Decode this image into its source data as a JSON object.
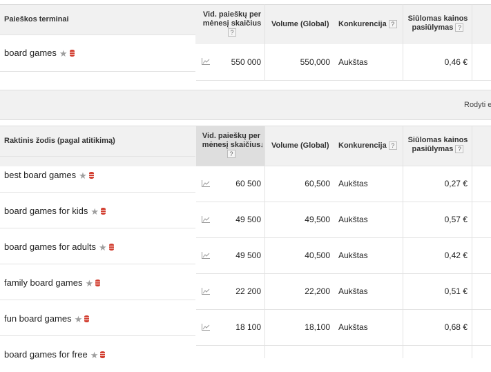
{
  "top_table": {
    "headers": {
      "search_terms": "Paieškos terminai",
      "avg_monthly": "Vid. paieškų per mėnesį skaičius",
      "volume": "Volume (Global)",
      "competition": "Konkurencija",
      "suggested_bid": "Siūlomas kainos pasiūlymas",
      "help": "?"
    },
    "row": {
      "keyword": "board games",
      "avg": "550 000",
      "volume": "550,000",
      "competition": "Aukštas",
      "bid": "0,46 €"
    }
  },
  "divider_bar": {
    "text": "Rodyti e"
  },
  "keyword_table": {
    "headers": {
      "keyword": "Raktinis žodis (pagal atitikimą)",
      "avg_monthly": "Vid. paieškų per mėnesį skaičius",
      "sort_arrow": "↓",
      "volume": "Volume (Global)",
      "competition": "Konkurencija",
      "suggested_bid": "Siūlomas kainos pasiūlymas",
      "help": "?"
    },
    "rows": [
      {
        "keyword": "best board games",
        "avg": "60 500",
        "volume": "60,500",
        "competition": "Aukštas",
        "bid": "0,27 €"
      },
      {
        "keyword": "board games for kids",
        "avg": "49 500",
        "volume": "49,500",
        "competition": "Aukštas",
        "bid": "0,57 €"
      },
      {
        "keyword": "board games for adults",
        "avg": "49 500",
        "volume": "40,500",
        "competition": "Aukštas",
        "bid": "0,42 €"
      },
      {
        "keyword": "family board games",
        "avg": "22 200",
        "volume": "22,200",
        "competition": "Aukštas",
        "bid": "0,51 €"
      },
      {
        "keyword": "fun board games",
        "avg": "18 100",
        "volume": "18,100",
        "competition": "Aukštas",
        "bid": "0,68 €"
      },
      {
        "keyword": "board games for free",
        "avg": "",
        "volume": "",
        "competition": "",
        "bid": ""
      }
    ]
  },
  "icons": {
    "star": "star-icon",
    "database": "database-icon",
    "trend": "trend-chart-icon"
  },
  "colors": {
    "header_bg": "#f1f1f1",
    "sorted_header_bg": "#dedede",
    "db_red": "#d23f31",
    "star_gray": "#9e9e9e"
  }
}
